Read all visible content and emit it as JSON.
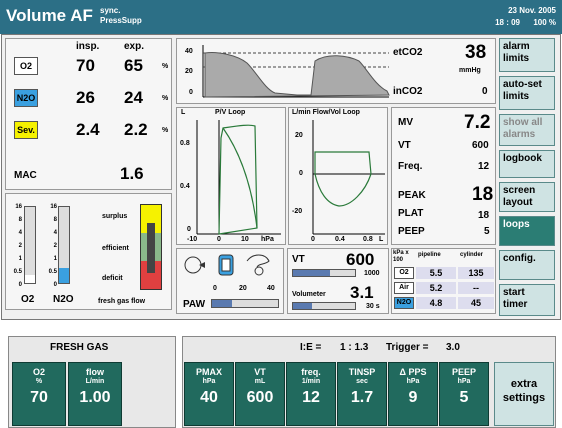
{
  "header": {
    "mode": "Volume AF",
    "sub1": "sync.",
    "sub2": "PressSupp",
    "date": "23 Nov. 2005",
    "time": "18 : 09",
    "battery": "100 %"
  },
  "gases": {
    "col_insp": "insp.",
    "col_exp": "exp.",
    "unit": "%",
    "rows": [
      {
        "name": "O2",
        "insp": "70",
        "exp": "65",
        "color": "#ffffff"
      },
      {
        "name": "N2O",
        "insp": "26",
        "exp": "24",
        "color": "#3aa0e0"
      },
      {
        "name": "Sev.",
        "insp": "2.4",
        "exp": "2.2",
        "color": "#f6f200"
      }
    ],
    "mac_label": "MAC",
    "mac_value": "1.6"
  },
  "flowmeters": {
    "scale": [
      "16",
      "8",
      "4",
      "2",
      "1",
      "0.5",
      "0"
    ],
    "o2_label": "O2",
    "n2o_label": "N2O",
    "o2_level": 0.1,
    "n2o_level": 0.2
  },
  "efficiency": {
    "surplus": "surplus",
    "efficient": "efficient",
    "deficit": "deficit",
    "caption": "fresh gas flow"
  },
  "capno": {
    "y_ticks": [
      "40",
      "20",
      "0"
    ],
    "etco2_label": "etCO2",
    "etco2_value": "38",
    "unit": "mmHg",
    "inco2_label": "inCO2",
    "inco2_value": "0"
  },
  "pv_loop": {
    "title": "P/V Loop",
    "y_unit": "L",
    "y_ticks": [
      "0.8",
      "0.4",
      "0"
    ],
    "x_ticks": [
      "-10",
      "0",
      "10"
    ],
    "x_unit": "hPa"
  },
  "fv_loop": {
    "title": "L/min Flow/Vol Loop",
    "y_ticks": [
      "20",
      "0",
      "-20"
    ],
    "x_ticks": [
      "0",
      "0.4",
      "0.8"
    ],
    "x_unit": "L"
  },
  "resp": {
    "mv_label": "MV",
    "mv_value": "7.2",
    "vt_label": "VT",
    "vt_value": "600",
    "freq_label": "Freq.",
    "freq_value": "12",
    "peak_label": "PEAK",
    "peak_value": "18",
    "plat_label": "PLAT",
    "plat_value": "18",
    "peep_label": "PEEP",
    "peep_value": "5"
  },
  "paw": {
    "label": "PAW",
    "ticks": [
      "0",
      "20",
      "40"
    ],
    "level": 0.3
  },
  "vt_bar": {
    "label": "VT",
    "value": "600",
    "max": "1000",
    "level": 0.6
  },
  "volumeter": {
    "label": "Volumeter",
    "value": "3.1",
    "time": "30 s",
    "level": 0.3
  },
  "supply": {
    "unit": "kPa x 100",
    "col1": "pipeline",
    "col2": "cylinder",
    "rows": [
      {
        "gas": "O2",
        "pipeline": "5.5",
        "cylinder": "135"
      },
      {
        "gas": "Air",
        "pipeline": "5.2",
        "cylinder": "--"
      },
      {
        "gas": "N2O",
        "pipeline": "4.8",
        "cylinder": "45"
      }
    ]
  },
  "side_menu": [
    {
      "label": "alarm limits",
      "active": false
    },
    {
      "label": "auto-set limits",
      "active": false
    },
    {
      "label": "show all alarms",
      "active": false
    },
    {
      "label": "logbook",
      "active": false
    },
    {
      "label": "screen layout",
      "active": false
    },
    {
      "label": "loops",
      "active": true
    },
    {
      "label": "config.",
      "active": false
    },
    {
      "label": "start timer",
      "active": false
    }
  ],
  "footer": {
    "fresh_gas_title": "FRESH GAS",
    "ie_label": "I:E =",
    "ie_value": "1 : 1.3",
    "trigger_label": "Trigger =",
    "trigger_value": "3.0",
    "fg_buttons": [
      {
        "name": "O2",
        "unit": "%",
        "value": "70"
      },
      {
        "name": "flow",
        "unit": "L/min",
        "value": "1.00"
      }
    ],
    "settings": [
      {
        "name": "PMAX",
        "unit": "hPa",
        "value": "40"
      },
      {
        "name": "VT",
        "unit": "mL",
        "value": "600"
      },
      {
        "name": "freq.",
        "unit": "1/min",
        "value": "12"
      },
      {
        "name": "TINSP",
        "unit": "sec",
        "value": "1.7"
      },
      {
        "name": "Δ PPS",
        "unit": "hPa",
        "value": "9"
      },
      {
        "name": "PEEP",
        "unit": "hPa",
        "value": "5"
      }
    ],
    "extra": "extra settings"
  }
}
